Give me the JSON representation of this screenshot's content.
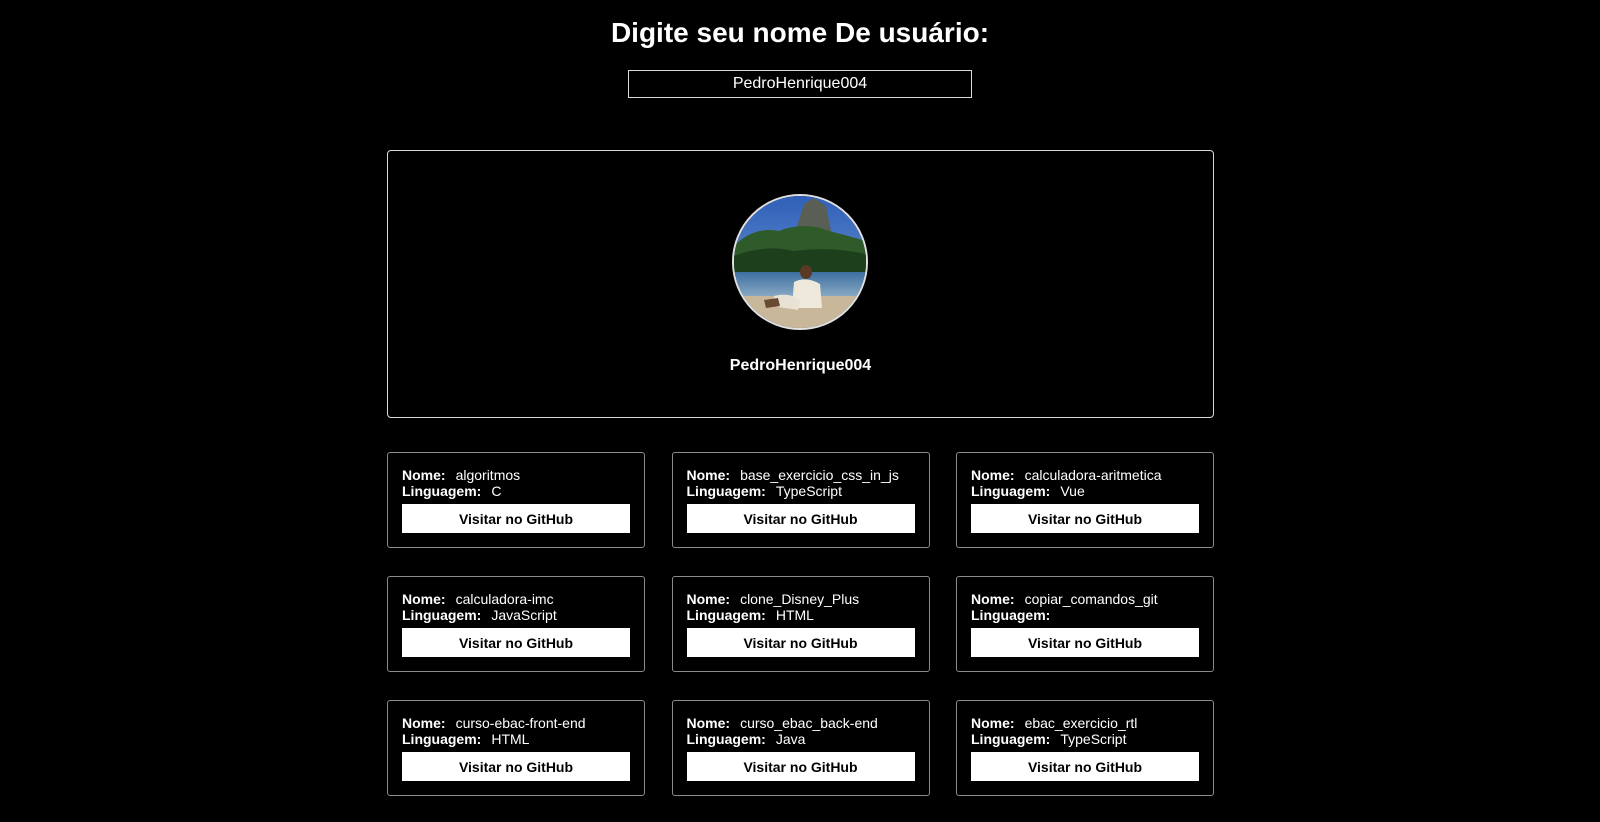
{
  "header": {
    "title": "Digite seu nome De usuário:"
  },
  "search": {
    "value": "PedroHenrique004"
  },
  "profile": {
    "name": "PedroHenrique004"
  },
  "labels": {
    "name": "Nome:",
    "language": "Linguagem:",
    "button": "Visitar no GitHub"
  },
  "repos": [
    {
      "name": "algoritmos",
      "language": "C"
    },
    {
      "name": "base_exercicio_css_in_js",
      "language": "TypeScript"
    },
    {
      "name": "calculadora-aritmetica",
      "language": "Vue"
    },
    {
      "name": "calculadora-imc",
      "language": "JavaScript"
    },
    {
      "name": "clone_Disney_Plus",
      "language": "HTML"
    },
    {
      "name": "copiar_comandos_git",
      "language": ""
    },
    {
      "name": "curso-ebac-front-end",
      "language": "HTML"
    },
    {
      "name": "curso_ebac_back-end",
      "language": "Java"
    },
    {
      "name": "ebac_exercicio_rtl",
      "language": "TypeScript"
    }
  ]
}
